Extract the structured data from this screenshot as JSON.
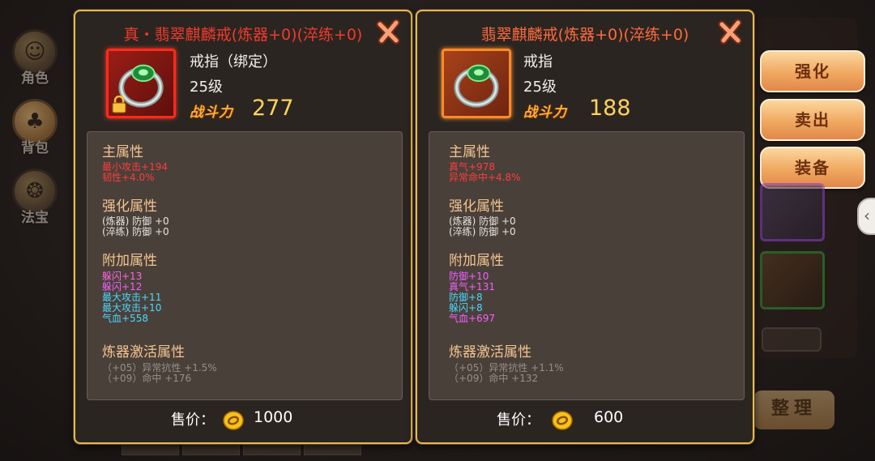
{
  "nav": [
    {
      "label": "角色",
      "icon": "character-icon"
    },
    {
      "label": "背包",
      "icon": "bag-icon"
    },
    {
      "label": "法宝",
      "icon": "treasure-icon"
    }
  ],
  "actions": {
    "strengthen": "强化",
    "sell": "卖出",
    "equip": "装备",
    "sort": "整理"
  },
  "item_left": {
    "title": "真・翡翠麒麟戒(炼器+0)(淬练+0)",
    "type": "戒指（绑定）",
    "level": "25级",
    "power_label": "战斗力",
    "power": "277",
    "locked": true,
    "main_title": "主属性",
    "main": [
      "最小攻击+194",
      "韧性+4.0%"
    ],
    "enhance_title": "强化属性",
    "enhance": [
      "(炼器) 防御 +0",
      "(淬练) 防御 +0"
    ],
    "extra_title": "附加属性",
    "extra": [
      "躲闪+13",
      "躲闪+12",
      "最大攻击+11",
      "最大攻击+10",
      "气血+558"
    ],
    "refine_title": "炼器激活属性",
    "refine": [
      "（+05）异常抗性 +1.5%",
      "（+09）命中 +176"
    ],
    "price_label": "售价：",
    "price": "1000"
  },
  "item_right": {
    "title": "翡翠麒麟戒(炼器+0)(淬练+0)",
    "type": "戒指",
    "level": "25级",
    "power_label": "战斗力",
    "power": "188",
    "locked": false,
    "main_title": "主属性",
    "main": [
      "真气+978",
      "异常命中+4.8%"
    ],
    "enhance_title": "强化属性",
    "enhance": [
      "(炼器) 防御 +0",
      "(淬练) 防御 +0"
    ],
    "extra_title": "附加属性",
    "extra": [
      "防御+10",
      "真气+131",
      "防御+8",
      "躲闪+8",
      "气血+697"
    ],
    "refine_title": "炼器激活属性",
    "refine": [
      "（+05）异常抗性 +1.1%",
      "（+09）命中 +132"
    ],
    "price_label": "售价：",
    "price": "600"
  },
  "colors": {
    "gold_border": "#e8b94f",
    "title_red": "#f13a2b",
    "title_orange": "#ff6a3c",
    "power_gold": "#ffd35a"
  }
}
